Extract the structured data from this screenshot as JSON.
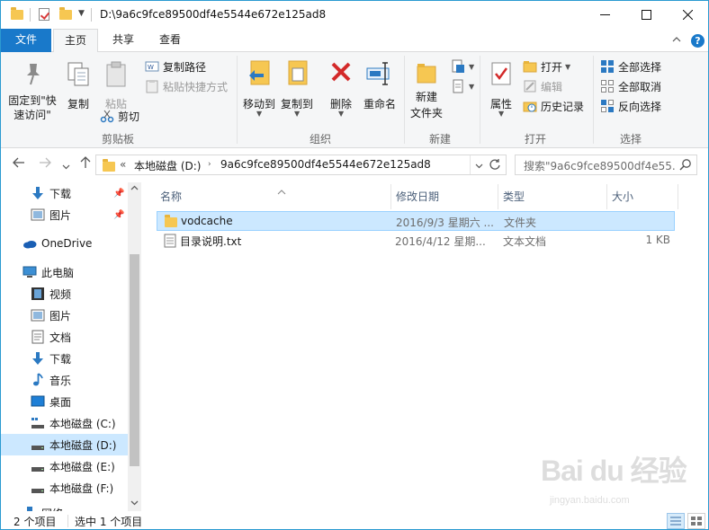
{
  "window": {
    "title": "D:\\9a6c9fce89500df4e5544e672e125ad8"
  },
  "tabs": [
    {
      "label": "文件"
    },
    {
      "label": "主页"
    },
    {
      "label": "共享"
    },
    {
      "label": "查看"
    }
  ],
  "ribbon": {
    "clipboard": {
      "pin_label": "固定到\"快速访问\"",
      "copy_label": "复制",
      "paste_label": "粘贴",
      "copy_path_label": "复制路径",
      "paste_shortcut_label": "粘贴快捷方式",
      "cut_label": "剪切",
      "group_label": "剪贴板"
    },
    "organize": {
      "move_to_label": "移动到",
      "copy_to_label": "复制到",
      "delete_label": "删除",
      "rename_label": "重命名",
      "group_label": "组织"
    },
    "new": {
      "new_folder_label": "新建\n文件夹",
      "group_label": "新建"
    },
    "open": {
      "properties_label": "属性",
      "open_label": "打开",
      "edit_label": "编辑",
      "history_label": "历史记录",
      "group_label": "打开"
    },
    "select": {
      "select_all_label": "全部选择",
      "select_none_label": "全部取消",
      "invert_label": "反向选择",
      "group_label": "选择"
    }
  },
  "address": {
    "chevron": "«",
    "segments": [
      "本地磁盘 (D:)",
      "9a6c9fce89500df4e5544e672e125ad8"
    ],
    "search_placeholder": "搜索\"9a6c9fce89500df4e55..."
  },
  "nav_pane": {
    "items": [
      {
        "label": "下载",
        "icon": "download-icon",
        "pinned": true
      },
      {
        "label": "图片",
        "icon": "pictures-icon",
        "pinned": true
      },
      {
        "label": "OneDrive",
        "icon": "onedrive-icon"
      },
      {
        "label": "此电脑",
        "icon": "this-pc-icon"
      },
      {
        "label": "视频",
        "icon": "video-icon"
      },
      {
        "label": "图片",
        "icon": "pictures-icon"
      },
      {
        "label": "文档",
        "icon": "documents-icon"
      },
      {
        "label": "下载",
        "icon": "download-icon"
      },
      {
        "label": "音乐",
        "icon": "music-icon"
      },
      {
        "label": "桌面",
        "icon": "desktop-icon"
      },
      {
        "label": "本地磁盘 (C:)",
        "icon": "drive-c-icon"
      },
      {
        "label": "本地磁盘 (D:)",
        "icon": "drive-icon",
        "selected": true
      },
      {
        "label": "本地磁盘 (E:)",
        "icon": "drive-icon"
      },
      {
        "label": "本地磁盘 (F:)",
        "icon": "drive-icon"
      },
      {
        "label": "网络",
        "icon": "network-icon"
      }
    ]
  },
  "file_list": {
    "columns": [
      "名称",
      "修改日期",
      "类型",
      "大小"
    ],
    "rows": [
      {
        "name": "vodcache",
        "date": "2016/9/3 星期六 ...",
        "type": "文件夹",
        "size": "",
        "icon": "folder-icon",
        "selected": true
      },
      {
        "name": "目录说明.txt",
        "date": "2016/4/12 星期...",
        "type": "文本文档",
        "size": "1 KB",
        "icon": "text-file-icon",
        "selected": false
      }
    ]
  },
  "status": {
    "item_count": "2 个项目",
    "selected_count": "选中 1 个项目"
  },
  "watermark": {
    "main": "Bai du 经验",
    "sub": "jingyan.baidu.com"
  }
}
